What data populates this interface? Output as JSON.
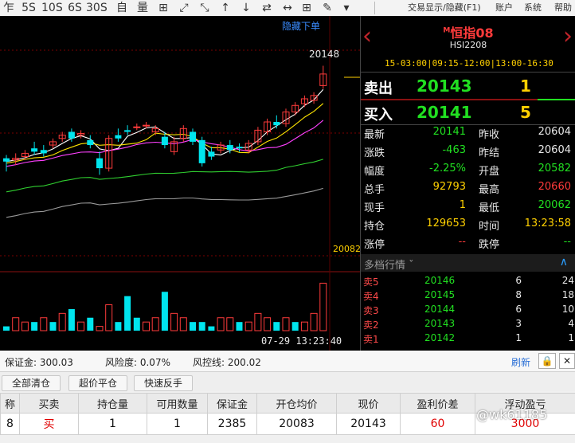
{
  "toolbar": {
    "buttons": [
      "乍",
      "5S",
      "10S",
      "6S",
      "30S",
      "自",
      "量",
      "⊞",
      "⤢",
      "⤡",
      "↑",
      "↓",
      "⇄",
      "↔",
      "⊞",
      "✎",
      "▾"
    ],
    "menu": [
      "交易显示/隐藏(F1)",
      "账户",
      "系统",
      "帮助"
    ]
  },
  "chart": {
    "hide_menu": "隐藏下单",
    "high_label": "20148",
    "mid_label": "20082",
    "time_label": "07-29 13:23:40",
    "colors": {
      "up": "#ff3b3b",
      "down": "#00e5ee",
      "ma_white": "#ffffff",
      "ma_yellow": "#ffe600",
      "ma_magenta": "#ff40ff",
      "ma_green": "#30d030",
      "ma_gray": "#9a9a9a"
    },
    "candles": [
      {
        "o": 20092,
        "c": 20090,
        "h": 20094,
        "l": 20084
      },
      {
        "o": 20091,
        "c": 20092,
        "h": 20095,
        "l": 20088
      },
      {
        "o": 20093,
        "c": 20095,
        "h": 20097,
        "l": 20091
      },
      {
        "o": 20098,
        "c": 20096,
        "h": 20102,
        "l": 20094
      },
      {
        "o": 20097,
        "c": 20095,
        "h": 20100,
        "l": 20093
      },
      {
        "o": 20100,
        "c": 20102,
        "h": 20104,
        "l": 20098
      },
      {
        "o": 20104,
        "c": 20106,
        "h": 20108,
        "l": 20102
      },
      {
        "o": 20108,
        "c": 20104,
        "h": 20110,
        "l": 20102
      },
      {
        "o": 20106,
        "c": 20107,
        "h": 20109,
        "l": 20104
      },
      {
        "o": 20103,
        "c": 20100,
        "h": 20106,
        "l": 20098
      },
      {
        "o": 20092,
        "c": 20086,
        "h": 20096,
        "l": 20082
      },
      {
        "o": 20086,
        "c": 20104,
        "h": 20106,
        "l": 20084
      },
      {
        "o": 20106,
        "c": 20104,
        "h": 20110,
        "l": 20102
      },
      {
        "o": 20109,
        "c": 20108,
        "h": 20112,
        "l": 20106
      },
      {
        "o": 20111,
        "c": 20111,
        "h": 20113,
        "l": 20109
      },
      {
        "o": 20112,
        "c": 20112,
        "h": 20114,
        "l": 20110
      },
      {
        "o": 20108,
        "c": 20110,
        "h": 20112,
        "l": 20106
      },
      {
        "o": 20105,
        "c": 20100,
        "h": 20108,
        "l": 20098
      },
      {
        "o": 20096,
        "c": 20102,
        "h": 20105,
        "l": 20094
      },
      {
        "o": 20104,
        "c": 20110,
        "h": 20112,
        "l": 20102
      },
      {
        "o": 20108,
        "c": 20102,
        "h": 20110,
        "l": 20100
      },
      {
        "o": 20103,
        "c": 20089,
        "h": 20105,
        "l": 20087
      },
      {
        "o": 20096,
        "c": 20093,
        "h": 20099,
        "l": 20091
      },
      {
        "o": 20097,
        "c": 20100,
        "h": 20102,
        "l": 20095
      },
      {
        "o": 20100,
        "c": 20097,
        "h": 20103,
        "l": 20095
      },
      {
        "o": 20099,
        "c": 20098,
        "h": 20101,
        "l": 20096
      },
      {
        "o": 20097,
        "c": 20101,
        "h": 20103,
        "l": 20095
      },
      {
        "o": 20102,
        "c": 20109,
        "h": 20111,
        "l": 20100
      },
      {
        "o": 20108,
        "c": 20114,
        "h": 20116,
        "l": 20106
      },
      {
        "o": 20114,
        "c": 20112,
        "h": 20118,
        "l": 20110
      },
      {
        "o": 20113,
        "c": 20120,
        "h": 20122,
        "l": 20111
      },
      {
        "o": 20120,
        "c": 20124,
        "h": 20126,
        "l": 20118
      },
      {
        "o": 20125,
        "c": 20128,
        "h": 20130,
        "l": 20123
      },
      {
        "o": 20127,
        "c": 20130,
        "h": 20132,
        "l": 20125
      },
      {
        "o": 20136,
        "c": 20143,
        "h": 20148,
        "l": 20134
      }
    ],
    "volumes": [
      1,
      3,
      2,
      2,
      3,
      2,
      4,
      5,
      2,
      3,
      1,
      6,
      2,
      8,
      3,
      2,
      3,
      9,
      4,
      3,
      2,
      2,
      1,
      3,
      3,
      2,
      2,
      4,
      3,
      2,
      3,
      2,
      2,
      4,
      11
    ],
    "volume_colors": [
      "down",
      "up",
      "up",
      "down",
      "up",
      "down",
      "up",
      "down",
      "up",
      "down",
      "up",
      "up",
      "down",
      "down",
      "down",
      "up",
      "up",
      "down",
      "up",
      "up",
      "down",
      "down",
      "down",
      "up",
      "up",
      "down",
      "up",
      "up",
      "up",
      "down",
      "up",
      "down",
      "up",
      "up",
      "up"
    ]
  },
  "panel": {
    "title": "恒指08",
    "title_mark": "M",
    "code": "HSI2208",
    "session": "15-03:00|09:15-12:00|13:00-16:30",
    "sell": {
      "label": "卖出",
      "price": "20143",
      "qty": "1"
    },
    "buy": {
      "label": "买入",
      "price": "20141",
      "qty": "5"
    },
    "quotes": [
      {
        "k1": "最新",
        "v1": "20141",
        "c1": "#21e021",
        "k2": "昨收",
        "v2": "20604",
        "c2": "#e8e8e8"
      },
      {
        "k1": "涨跌",
        "v1": "-463",
        "c1": "#21e021",
        "k2": "昨结",
        "v2": "20604",
        "c2": "#e8e8e8"
      },
      {
        "k1": "幅度",
        "v1": "-2.25%",
        "c1": "#21e021",
        "k2": "开盘",
        "v2": "20582",
        "c2": "#21e021"
      },
      {
        "k1": "总手",
        "v1": "92793",
        "c1": "#ffd000",
        "k2": "最高",
        "v2": "20660",
        "c2": "#ff3b3b"
      },
      {
        "k1": "现手",
        "v1": "1",
        "c1": "#ffd000",
        "k2": "最低",
        "v2": "20062",
        "c2": "#21e021"
      },
      {
        "k1": "持仓",
        "v1": "129653",
        "c1": "#ffd000",
        "k2": "时间",
        "v2": "13:23:58",
        "c2": "#ffd000"
      },
      {
        "k1": "涨停",
        "v1": "--",
        "c1": "#ff3b3b",
        "k2": "跌停",
        "v2": "--",
        "c2": "#21e021"
      }
    ],
    "depth_title": "多档行情",
    "depth": [
      {
        "label": "卖5",
        "price": "20146",
        "vol": "6",
        "vol2": "24"
      },
      {
        "label": "卖4",
        "price": "20145",
        "vol": "8",
        "vol2": "18"
      },
      {
        "label": "卖3",
        "price": "20144",
        "vol": "6",
        "vol2": "10"
      },
      {
        "label": "卖2",
        "price": "20143",
        "vol": "3",
        "vol2": "4"
      },
      {
        "label": "卖1",
        "price": "20142",
        "vol": "1",
        "vol2": "1"
      }
    ]
  },
  "bottom": {
    "margin": "保证金: 300.03",
    "risk": "风险度: 0.07%",
    "control": "风控线: 200.02",
    "refresh": "刷新",
    "buttons": [
      "全部清仓",
      "超价平仓",
      "快速反手"
    ],
    "columns": [
      "称",
      "买卖",
      "持仓量",
      "可用数量",
      "保证金",
      "开仓均价",
      "现价",
      "盈利价差",
      "浮动盈亏"
    ],
    "row": [
      "8",
      "买",
      "1",
      "1",
      "2385",
      "20083",
      "20143",
      "60",
      "3000"
    ],
    "watermark": "@wk61185"
  }
}
